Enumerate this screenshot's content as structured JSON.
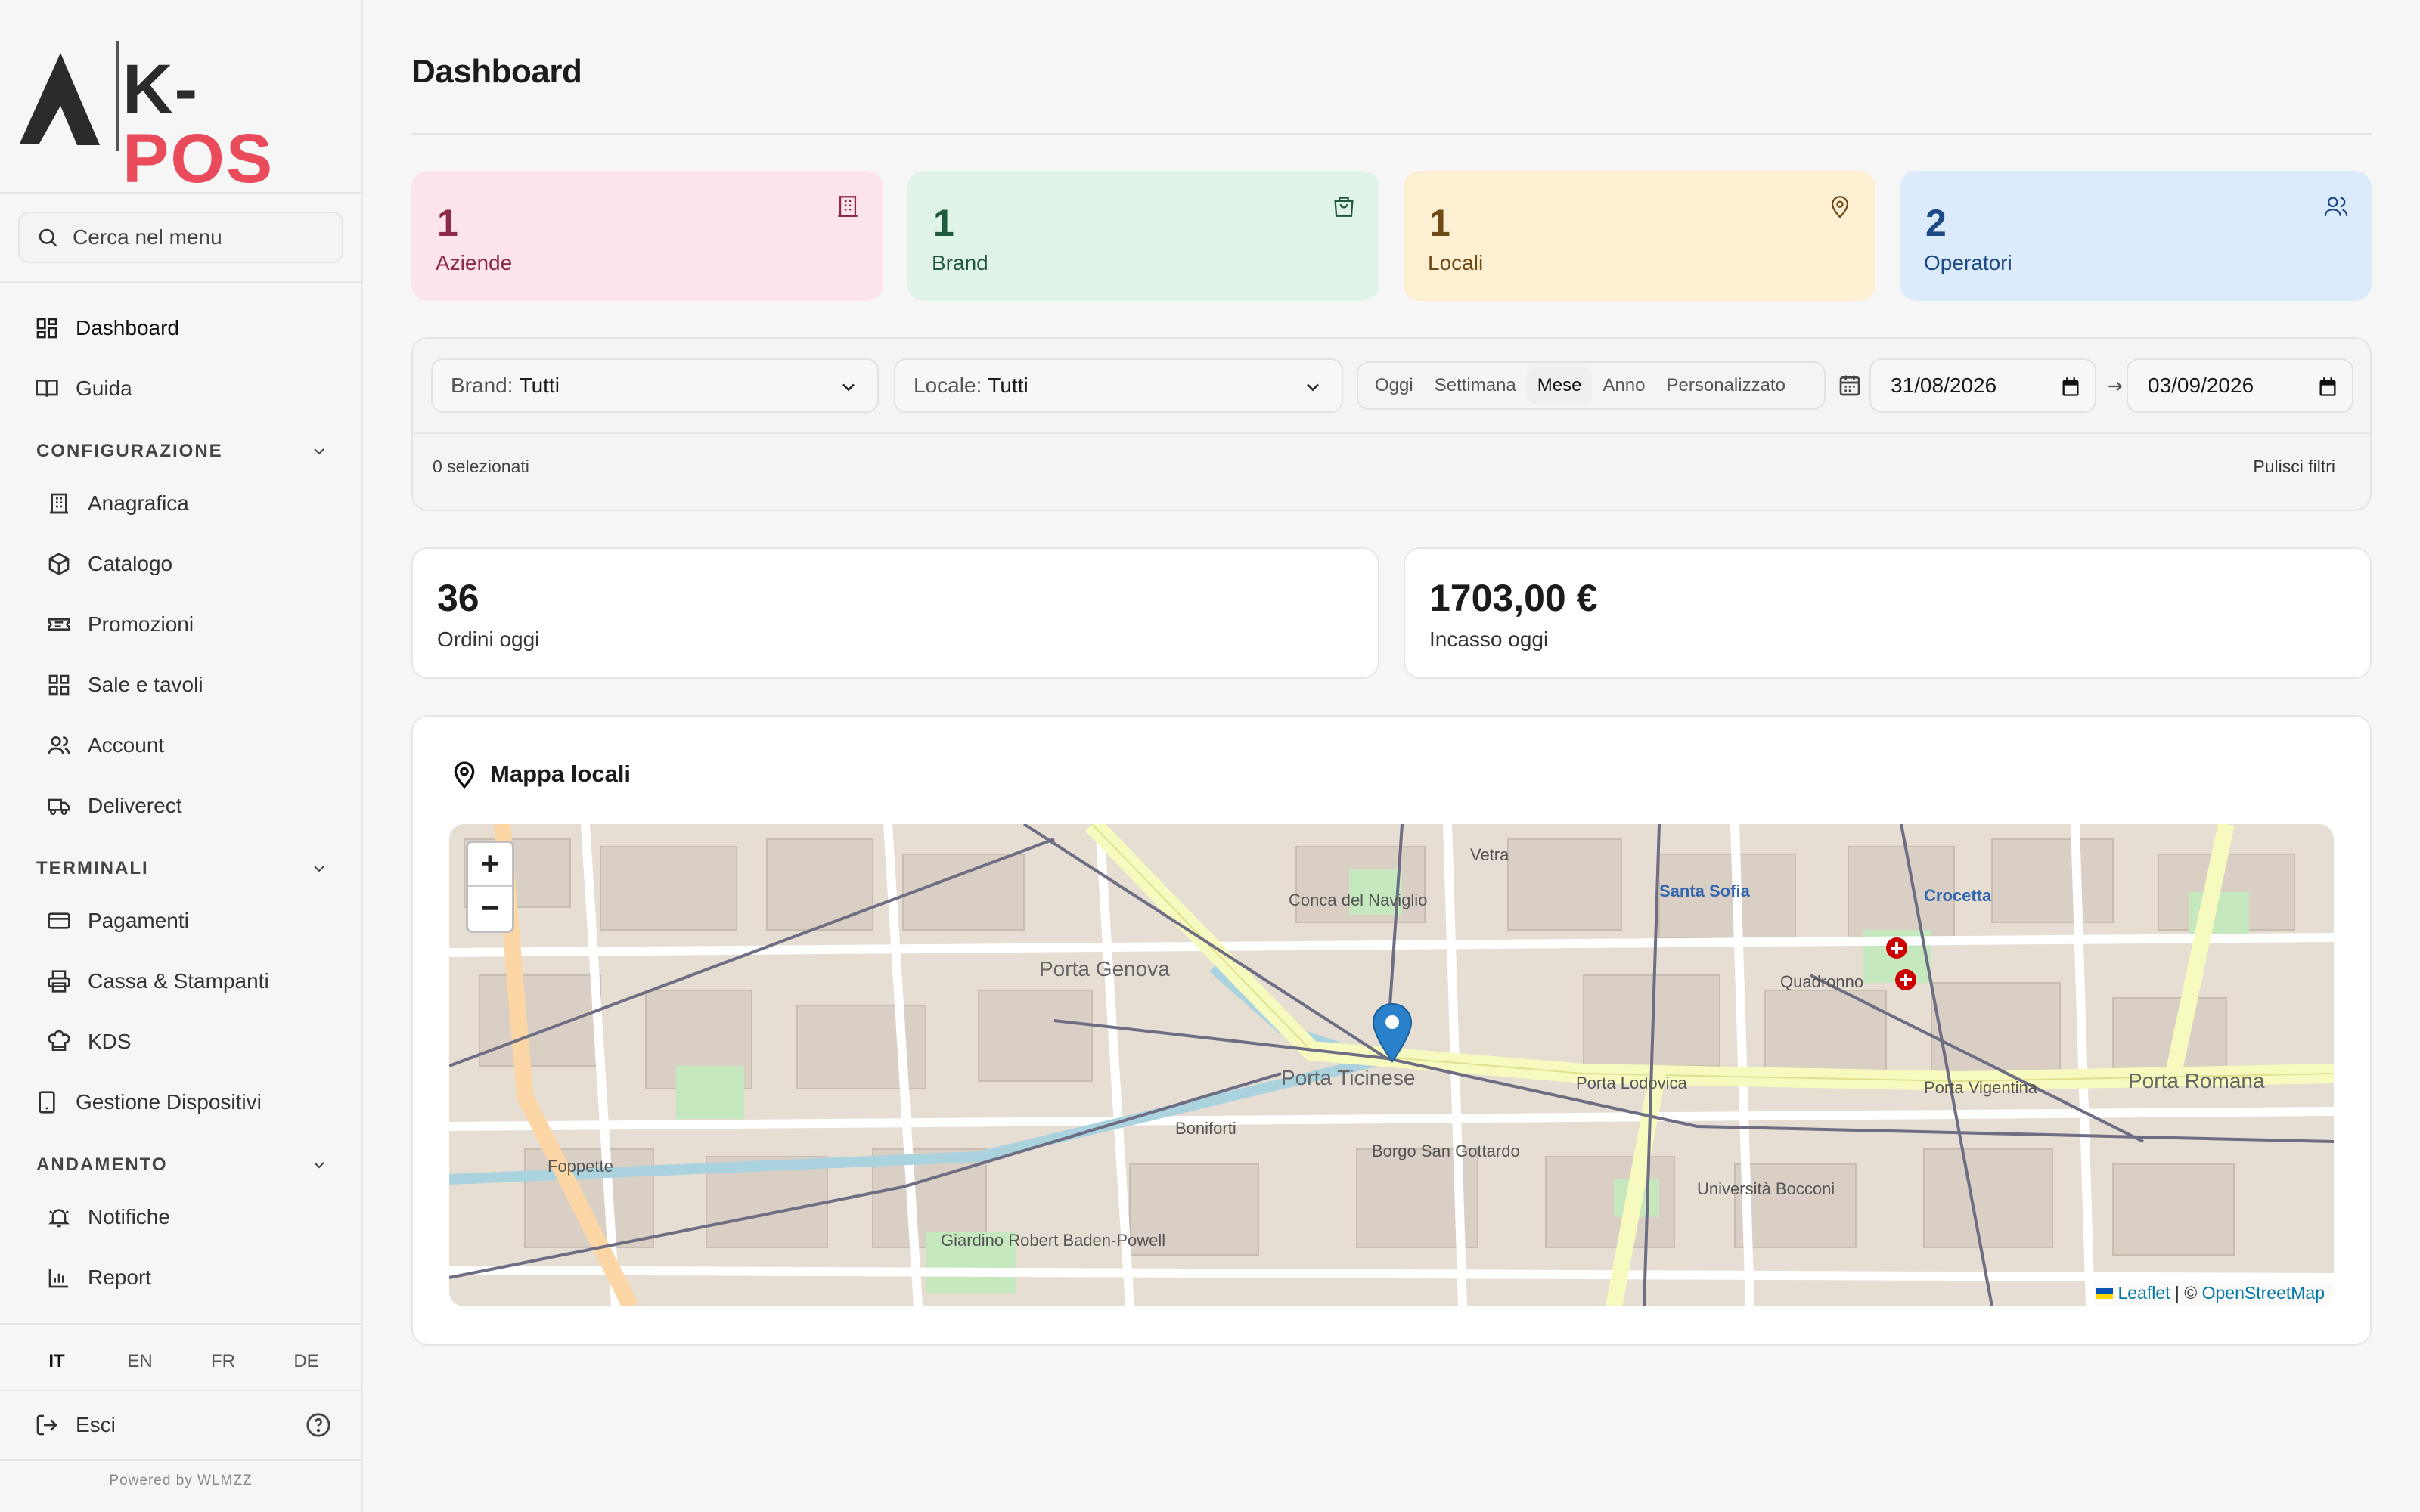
{
  "brand": {
    "logo_k": "K-",
    "logo_pos": "POS"
  },
  "sidebar": {
    "search_placeholder": "Cerca nel menu",
    "top_items": [
      {
        "label": "Dashboard",
        "icon": "dashboard-icon"
      },
      {
        "label": "Guida",
        "icon": "book-icon"
      }
    ],
    "sections": [
      {
        "title": "CONFIGURAZIONE",
        "items": [
          {
            "label": "Anagrafica",
            "icon": "building-icon"
          },
          {
            "label": "Catalogo",
            "icon": "box-icon"
          },
          {
            "label": "Promozioni",
            "icon": "ticket-icon"
          },
          {
            "label": "Sale e tavoli",
            "icon": "grid-icon"
          },
          {
            "label": "Account",
            "icon": "users-icon"
          },
          {
            "label": "Deliverect",
            "icon": "truck-icon"
          }
        ]
      },
      {
        "title": "TERMINALI",
        "items": [
          {
            "label": "Pagamenti",
            "icon": "credit-card-icon"
          },
          {
            "label": "Cassa & Stampanti",
            "icon": "printer-icon"
          },
          {
            "label": "KDS",
            "icon": "chef-hat-icon"
          }
        ]
      },
      {
        "title": "ANDAMENTO",
        "items": [
          {
            "label": "Notifiche",
            "icon": "bell-icon"
          },
          {
            "label": "Report",
            "icon": "bar-chart-icon"
          }
        ]
      }
    ],
    "device_item": {
      "label": "Gestione Dispositivi",
      "icon": "tablet-icon"
    },
    "languages": [
      "IT",
      "EN",
      "FR",
      "DE"
    ],
    "active_language": "IT",
    "logout": "Esci",
    "powered_by": "Powered by WLMZZ"
  },
  "page": {
    "title": "Dashboard"
  },
  "stats": [
    {
      "value": "1",
      "label": "Aziende",
      "icon": "building-icon",
      "bg": "#fce4ea",
      "fg": "#8a2a45"
    },
    {
      "value": "1",
      "label": "Brand",
      "icon": "shopping-bag-icon",
      "bg": "#dff3e8",
      "fg": "#1f5a3c"
    },
    {
      "value": "1",
      "label": "Locali",
      "icon": "map-pin-icon",
      "bg": "#fdefd2",
      "fg": "#6e4a14"
    },
    {
      "value": "2",
      "label": "Operatori",
      "icon": "users-icon",
      "bg": "#dcebfc",
      "fg": "#1d4a86"
    }
  ],
  "filters": {
    "brand_label": "Brand:",
    "brand_value": "Tutti",
    "locale_label": "Locale:",
    "locale_value": "Tutti",
    "periods": [
      "Oggi",
      "Settimana",
      "Mese",
      "Anno",
      "Personalizzato"
    ],
    "active_period": "Mese",
    "date_from": "31/08/2026",
    "date_to": "03/09/2026",
    "selected_count": "0 selezionati",
    "clear_label": "Pulisci filtri"
  },
  "kpis": [
    {
      "value": "36",
      "label": "Ordini oggi"
    },
    {
      "value": "1703,00 €",
      "label": "Incasso oggi"
    }
  ],
  "map": {
    "title": "Mappa locali",
    "zoom_in": "+",
    "zoom_out": "−",
    "attribution_leaflet": "Leaflet",
    "attribution_sep": " | © ",
    "attribution_osm": "OpenStreetMap",
    "labels": [
      {
        "text": "Porta Genova"
      },
      {
        "text": "Porta Ticinese"
      },
      {
        "text": "Porta Lodovica"
      },
      {
        "text": "Porta Vigentina"
      },
      {
        "text": "Porta Romana"
      },
      {
        "text": "Quadronno"
      },
      {
        "text": "Crocetta"
      },
      {
        "text": "Santa Sofia"
      },
      {
        "text": "Conca del Naviglio"
      },
      {
        "text": "Vetra"
      },
      {
        "text": "Foppette"
      },
      {
        "text": "Boniforti"
      },
      {
        "text": "Borgo San Gottardo"
      },
      {
        "text": "Università Bocconi"
      },
      {
        "text": "Giardino Robert Baden-Powell"
      }
    ]
  }
}
